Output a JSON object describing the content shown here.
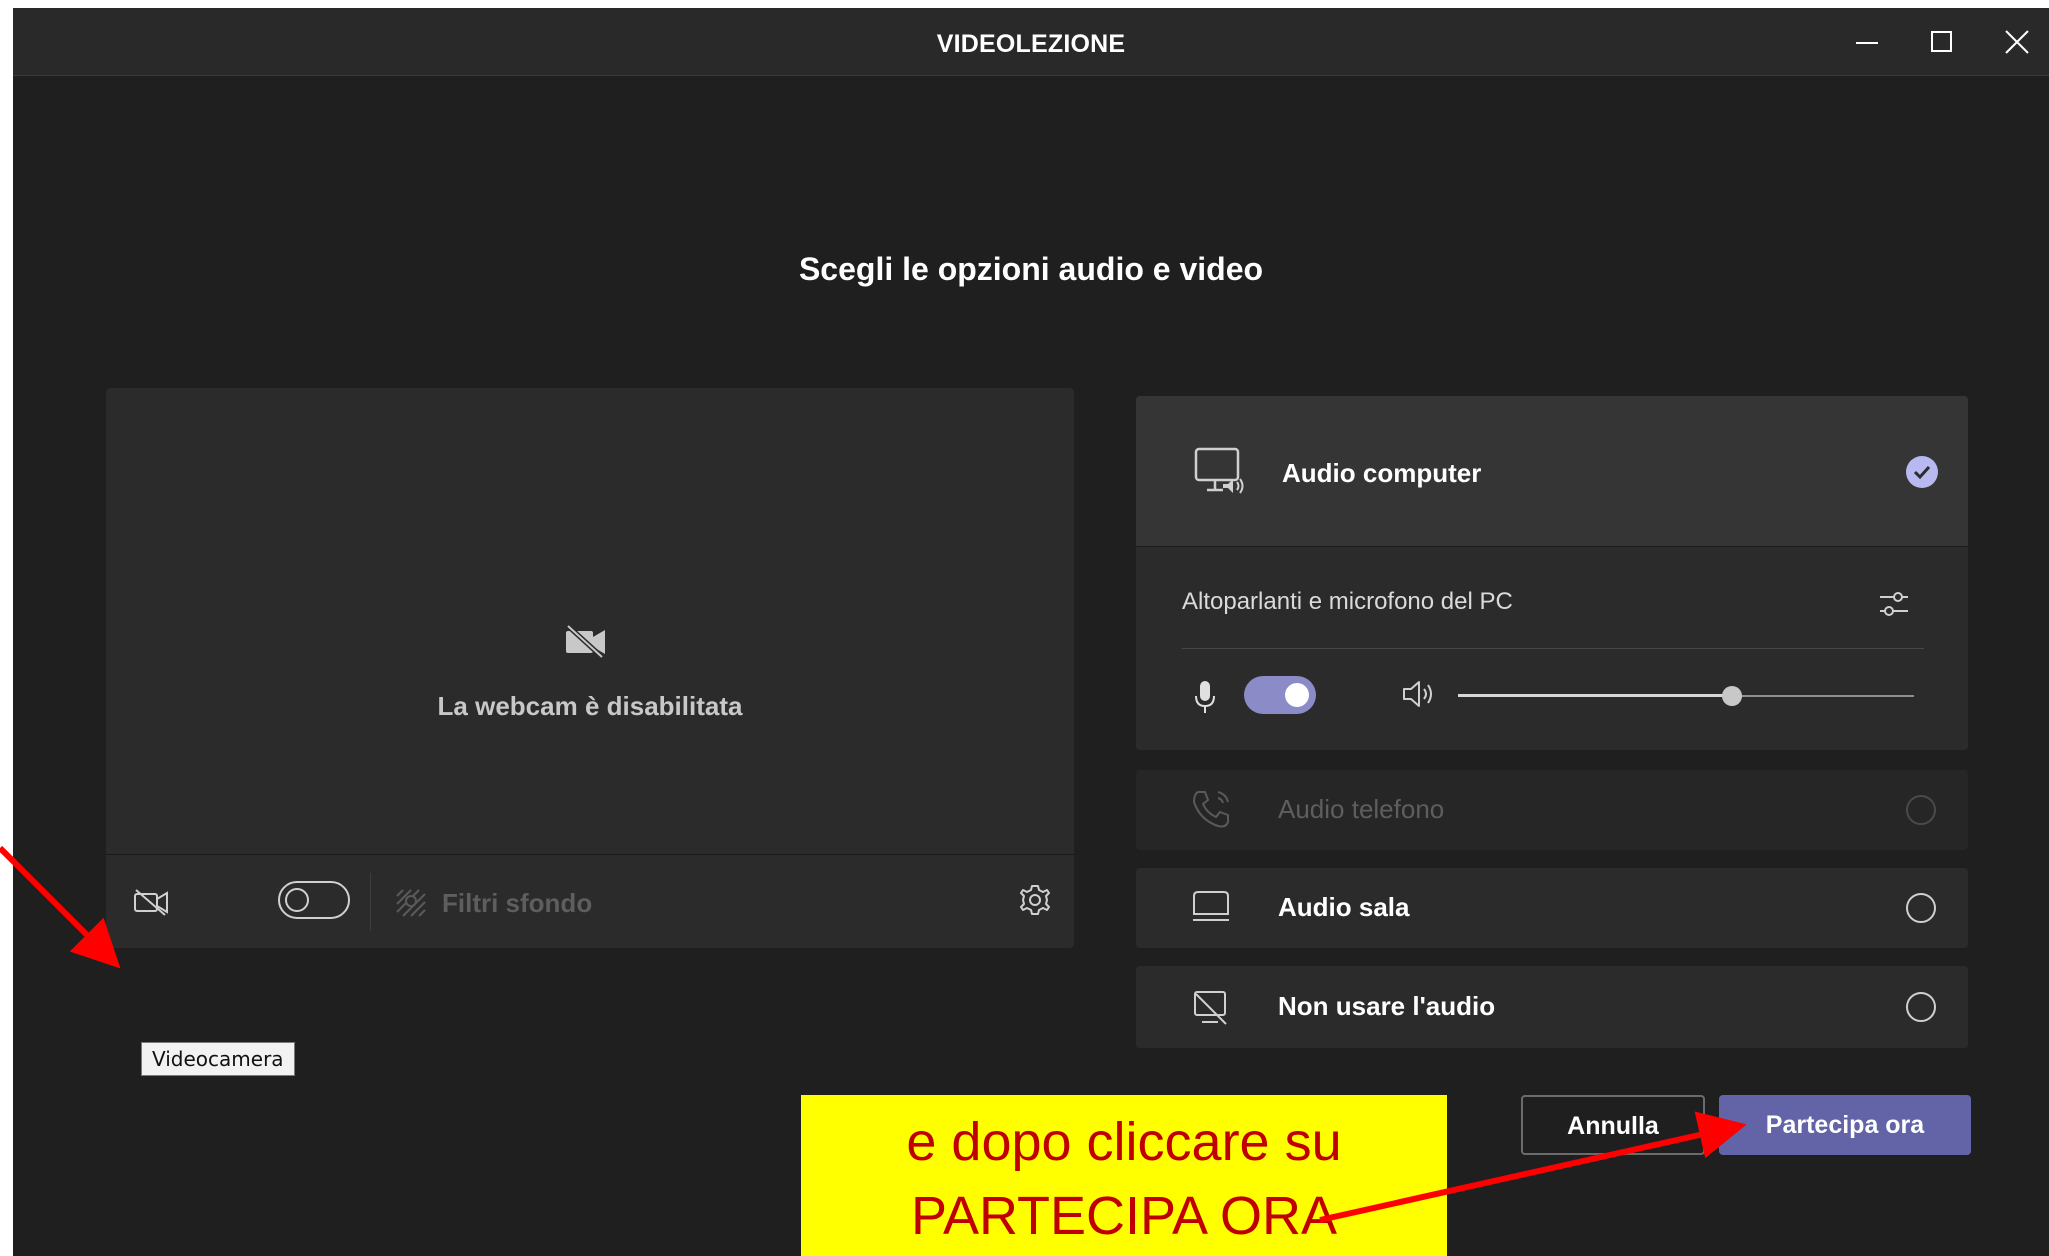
{
  "window": {
    "title": "VIDEOLEZIONE",
    "controls": [
      "minimize-icon",
      "maximize-icon",
      "close-icon"
    ]
  },
  "heading": "Scegli le opzioni audio e video",
  "video_panel": {
    "status_text": "La webcam è disabilitata",
    "camera_toggle_on": false,
    "background_filters_label": "Filtri sfondo",
    "tooltip": "Videocamera"
  },
  "audio_options": [
    {
      "label": "Audio computer",
      "selected": true,
      "enabled": true,
      "icon": "computer-audio-icon"
    },
    {
      "label": "Audio telefono",
      "selected": false,
      "enabled": false,
      "icon": "phone-icon"
    },
    {
      "label": "Audio sala",
      "selected": false,
      "enabled": true,
      "icon": "room-audio-icon"
    },
    {
      "label": "Non usare l'audio",
      "selected": false,
      "enabled": true,
      "icon": "no-audio-icon"
    }
  ],
  "computer_audio": {
    "device_label": "Altoparlanti e microfono del PC",
    "mic_on": true,
    "volume_level": 0.6
  },
  "buttons": {
    "cancel": "Annulla",
    "join": "Partecipa ora"
  },
  "annotation": {
    "line1": "e dopo cliccare su",
    "line2": "PARTECIPA ORA"
  },
  "colors": {
    "accent": "#6264a7",
    "toggle_on": "#8b8cc7",
    "check": "#b7b9f0",
    "annotation_bg": "#ffff00",
    "annotation_text": "#c00000",
    "arrow": "#ff0000"
  }
}
